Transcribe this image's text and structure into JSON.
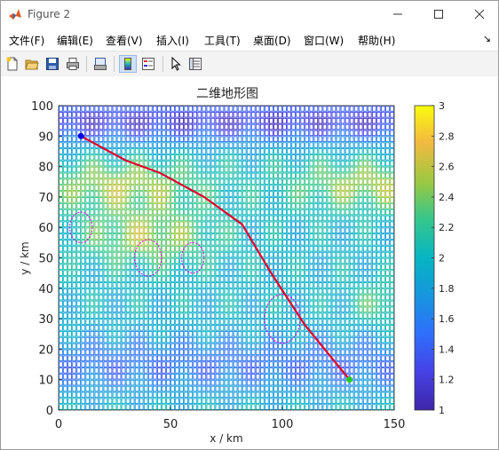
{
  "window": {
    "title": "Figure 2"
  },
  "menu": [
    "文件(F)",
    "编辑(E)",
    "查看(V)",
    "插入(I)",
    "工具(T)",
    "桌面(D)",
    "窗口(W)",
    "帮助(H)"
  ],
  "toolbar_icons": [
    "new-figure-icon",
    "open-file-icon",
    "save-icon",
    "print-icon",
    "print-preview-icon",
    "colorbar-icon",
    "legend-icon",
    "pointer-icon",
    "property-inspector-icon"
  ],
  "chart_data": {
    "type": "heatmap",
    "title": "二维地形图",
    "xlabel": "x / km",
    "ylabel": "y / km",
    "xlim": [
      0,
      150
    ],
    "ylim": [
      0,
      100
    ],
    "xticks": [
      0,
      50,
      100,
      150
    ],
    "yticks": [
      0,
      10,
      20,
      30,
      40,
      50,
      60,
      70,
      80,
      90,
      100
    ],
    "colorbar": {
      "min": 1,
      "max": 3,
      "ticks": [
        "1",
        "1.2",
        "1.4",
        "1.6",
        "1.8",
        "2",
        "2.2",
        "2.4",
        "2.6",
        "2.8",
        "3"
      ]
    },
    "path": {
      "color": "#e0002a",
      "x": [
        10,
        30,
        45,
        65,
        82,
        95,
        110,
        130
      ],
      "y": [
        90,
        82,
        78,
        70,
        61,
        45,
        28,
        10
      ]
    },
    "start_point": {
      "x": 10,
      "y": 90,
      "color": "#0000ee"
    },
    "end_point": {
      "x": 130,
      "y": 10,
      "color": "#22cc22"
    },
    "obstacles": [
      {
        "cx": 10,
        "cy": 60,
        "rx": 5,
        "ry": 5
      },
      {
        "cx": 40,
        "cy": 50,
        "rx": 6,
        "ry": 6
      },
      {
        "cx": 60,
        "cy": 50,
        "rx": 5,
        "ry": 5
      },
      {
        "cx": 100,
        "cy": 30,
        "rx": 8,
        "ry": 8
      }
    ]
  }
}
